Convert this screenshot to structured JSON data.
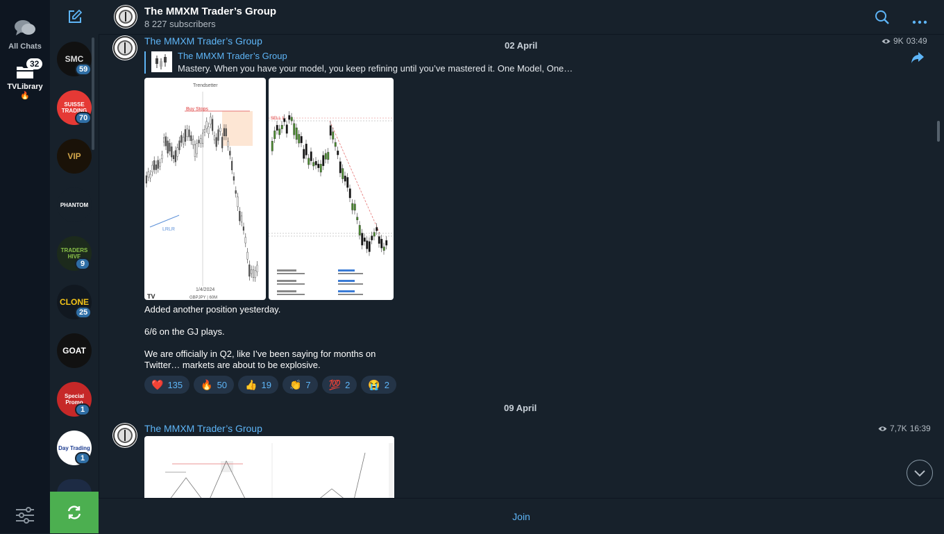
{
  "folders": [
    {
      "label": "All Chats"
    },
    {
      "label": "TVLibrary",
      "badge": "32",
      "emoji": "🔥"
    }
  ],
  "chatlist": [
    {
      "initials": "SMC",
      "unread": "59",
      "bg": "#111111",
      "fg": "#dddddd"
    },
    {
      "initials": "SUISSE TRADING",
      "unread": "70",
      "bg": "#e53935",
      "fg": "#ffffff"
    },
    {
      "initials": "VIP",
      "unread": "",
      "bg": "#1a1208",
      "fg": "#d4a84b"
    },
    {
      "initials": "PHANTOM",
      "unread": "",
      "bg": "#17212b",
      "fg": "#ffffff"
    },
    {
      "initials": "TRADERS HIVE",
      "unread": "9",
      "bg": "#1c2a1c",
      "fg": "#8bc34a"
    },
    {
      "initials": "CLONE",
      "unread": "25",
      "bg": "#111820",
      "fg": "#f5c518"
    },
    {
      "initials": "GOAT",
      "unread": "",
      "bg": "#111111",
      "fg": "#ffffff"
    },
    {
      "initials": "Special Promo",
      "unread": "1",
      "bg": "#c62828",
      "fg": "#ffffff"
    },
    {
      "initials": "Day Trading",
      "unread": "1",
      "bg": "#ffffff",
      "fg": "#1a3a8f"
    }
  ],
  "header": {
    "title": "The MMXM Trader’s Group",
    "subtitle": "8 227 subscribers"
  },
  "messages": [
    {
      "author": "The MMXM Trader’s Group",
      "date": "02 April",
      "views": "9K",
      "time": "03:49",
      "forward": {
        "name": "The MMXM Trader’s Group",
        "text": "Mastery.   When you have your model, you keep refining until you’ve mastered it.  One Model, One…"
      },
      "image1": {
        "title": "Trendsetter",
        "note": "Buy Stops",
        "label": "LRLR",
        "date": "1/4/2024",
        "symbol": "GBPJPY | 60M"
      },
      "image2": {
        "note": "SELL 1"
      },
      "lines": [
        "Added another position yesterday.",
        "6/6 on the GJ plays.",
        "We are officially in Q2, like I’ve been saying for months on Twitter… markets are about to be explosive."
      ],
      "reactions": [
        {
          "emoji": "❤️",
          "count": "135"
        },
        {
          "emoji": "🔥",
          "count": "50"
        },
        {
          "emoji": "👍",
          "count": "19"
        },
        {
          "emoji": "👏",
          "count": "7"
        },
        {
          "emoji": "💯",
          "count": "2"
        },
        {
          "emoji": "😭",
          "count": "2"
        }
      ]
    },
    {
      "author": "The MMXM Trader’s Group",
      "date": "09 April",
      "views": "7,7K",
      "time": "16:39"
    }
  ],
  "composer": {
    "join_label": "Join"
  },
  "colors": {
    "accent": "#5eb5f7",
    "bg": "#17212b",
    "sidebar": "#0e1621",
    "refresh": "#4caf50"
  }
}
